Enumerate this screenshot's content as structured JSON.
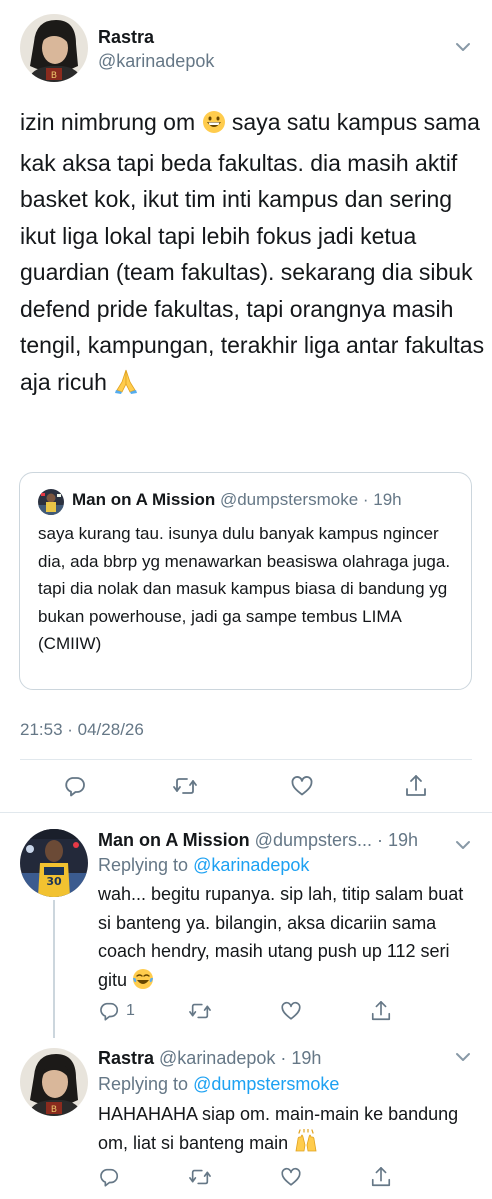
{
  "main_tweet": {
    "author_name": "Rastra",
    "author_handle": "@karinadepok",
    "text_part1": "izin nimbrung om ",
    "text_part2": " saya satu kampus sama kak aksa tapi beda fakultas. dia masih aktif basket kok, ikut tim inti kampus dan sering ikut liga lokal tapi lebih fokus jadi ketua guardian (team fakultas). sekarang dia sibuk defend pride fakultas, tapi orangnya masih tengil, kampungan, terakhir liga antar fakultas aja ricuh ",
    "emoji_1": "grinning-face-emoji",
    "emoji_2": "folded-hands-emoji",
    "timestamp": "21:53 · 04/28/26",
    "quoted_tweet": {
      "author_name": "Man on A Mission",
      "author_meta": " @dumpstersmoke · 19h",
      "text": "saya kurang tau. isunya dulu banyak kampus ngincer dia, ada bbrp yg menawarkan beasiswa olahraga juga. tapi dia nolak dan masuk kampus biasa di bandung yg bukan powerhouse, jadi ga sampe tembus LIMA (CMIIW)"
    },
    "actions": [
      "reply-icon",
      "retweet-icon",
      "like-icon",
      "share-icon"
    ]
  },
  "replies": [
    {
      "author_name": "Man on A Mission",
      "author_meta": " @dumpsters... · 19h",
      "replying_prefix": "Replying to ",
      "replying_to": "@karinadepok",
      "text": "wah... begitu rupanya. sip lah, titip salam buat si banteng ya. bilangin, aksa dicariin sama coach hendry, masih utang push up 112 seri gitu ",
      "emoji": "face-with-tears-of-joy-emoji",
      "reply_count": "1"
    },
    {
      "author_name": "Rastra",
      "author_meta": " @karinadepok · 19h",
      "replying_prefix": "Replying to ",
      "replying_to": "@dumpstersmoke",
      "text": "HAHAHAHA siap om. main-main ke bandung om, liat si banteng main ",
      "emoji": "raising-hands-emoji"
    }
  ],
  "colors": {
    "text_primary": "#14171a",
    "text_secondary": "#657786",
    "link": "#1da1f2",
    "border": "#e1e8ed"
  }
}
